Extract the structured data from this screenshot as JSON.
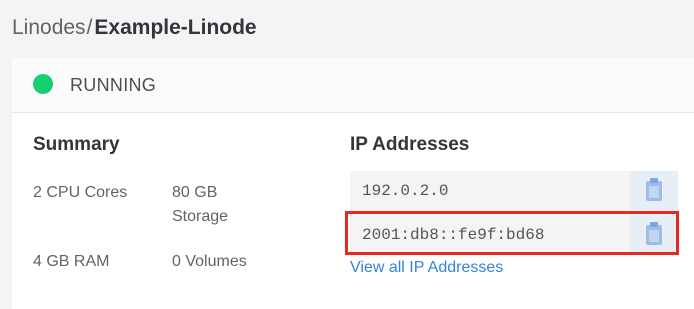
{
  "breadcrumb": {
    "parent": "Linodes",
    "separator": "/",
    "current": "Example-Linode"
  },
  "status": {
    "label": "RUNNING",
    "color": "#17cf73"
  },
  "summary": {
    "title": "Summary",
    "cpu": "2 CPU Cores",
    "storage": "80 GB Storage",
    "ram": "4 GB RAM",
    "volumes": "0 Volumes"
  },
  "ip_addresses": {
    "title": "IP Addresses",
    "items": [
      {
        "address": "192.0.2.0",
        "copy_icon": "clipboard-icon"
      },
      {
        "address": "2001:db8::fe9f:bd68",
        "copy_icon": "clipboard-icon"
      }
    ],
    "view_all_label": "View all IP Addresses",
    "link_color": "#3683dc"
  },
  "annotation": {
    "highlight_color": "#e8281d"
  }
}
